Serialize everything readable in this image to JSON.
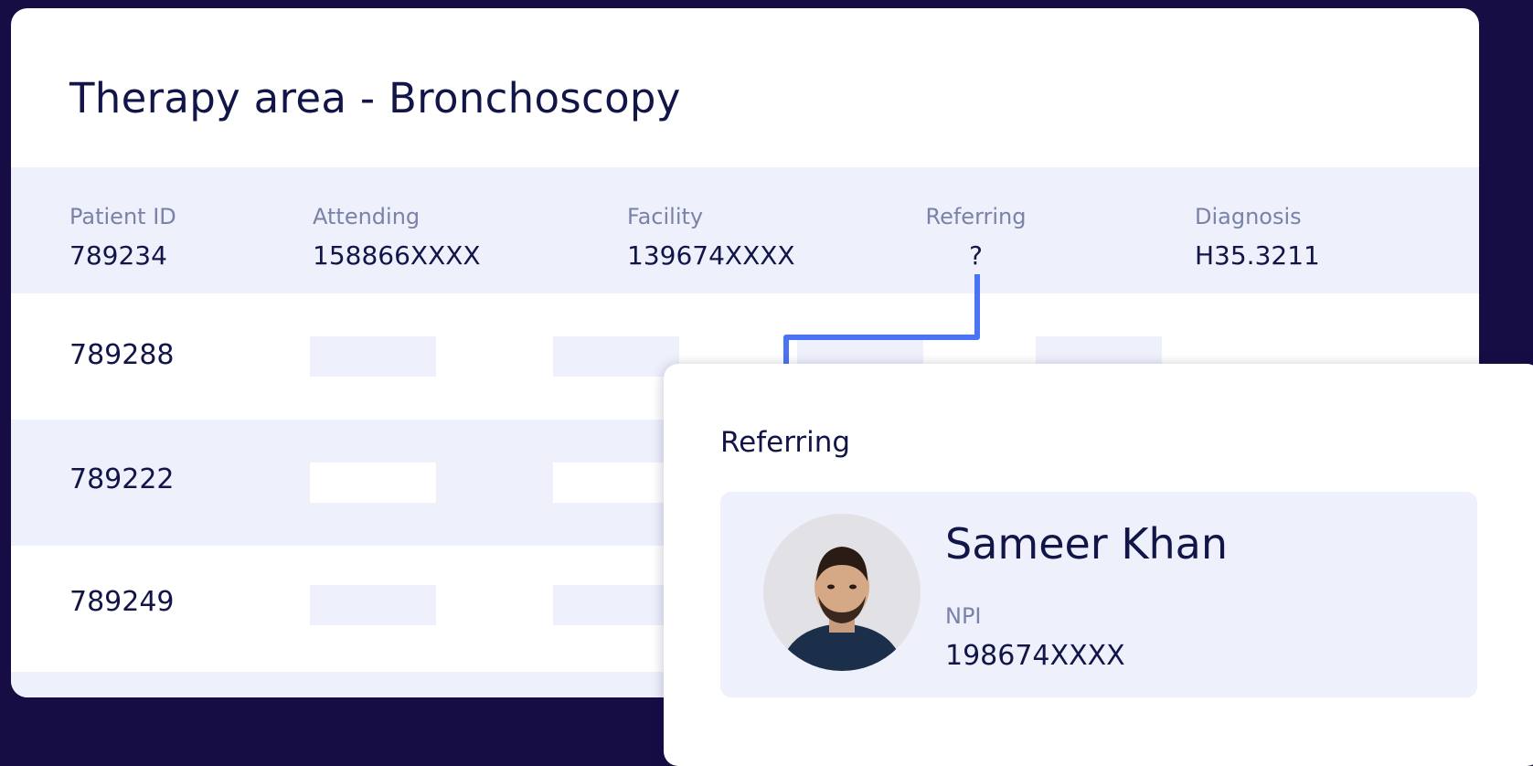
{
  "title": "Therapy area - Bronchoscopy",
  "header": {
    "columns": [
      {
        "label": "Patient ID",
        "value": "789234"
      },
      {
        "label": "Attending",
        "value": "158866XXXX"
      },
      {
        "label": "Facility",
        "value": "139674XXXX"
      },
      {
        "label": "Referring",
        "value": "?"
      },
      {
        "label": "Diagnosis",
        "value": "H35.3211"
      }
    ]
  },
  "rows": [
    {
      "patient_id": "789288"
    },
    {
      "patient_id": "789222"
    },
    {
      "patient_id": "789249"
    }
  ],
  "popup": {
    "title": "Referring",
    "name": "Sameer Khan",
    "npi_label": "NPI",
    "npi_value": "198674XXXX",
    "avatar_icon": "person-photo-icon"
  },
  "colors": {
    "background": "#170d45",
    "card": "#ffffff",
    "row_tint": "#eef0fc",
    "text_dark": "#121547",
    "text_muted": "#7a82a8",
    "accent": "#4a74f5"
  }
}
